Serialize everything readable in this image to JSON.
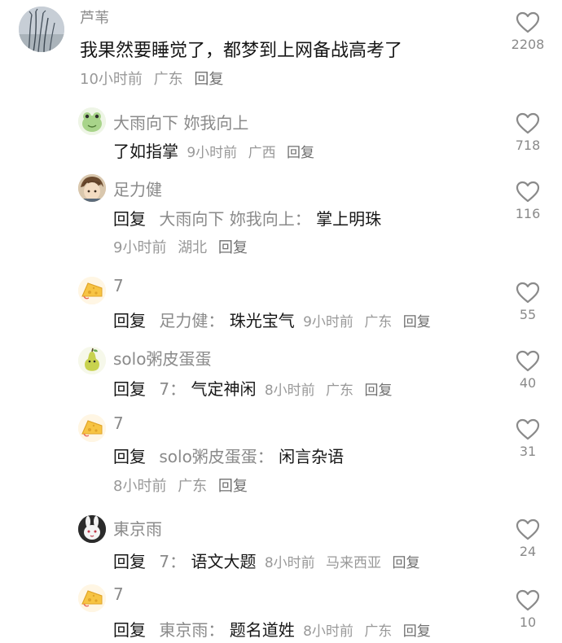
{
  "root_comment": {
    "username": "芦苇",
    "text": "我果然要睡觉了，都梦到上网备战高考了",
    "time": "10小时前",
    "location": "广东",
    "reply_label": "回复",
    "likes": "2208",
    "avatar": "reed-photo-avatar"
  },
  "replies": [
    {
      "username": "大雨向下 妳我向上",
      "prefix": "",
      "target": "",
      "text": "了如指掌",
      "time": "9小时前",
      "location": "广西",
      "reply_label": "回复",
      "likes": "718",
      "avatar": "frog-avatar"
    },
    {
      "username": "足力健",
      "prefix": "回复",
      "target": "大雨向下 妳我向上：",
      "text": "掌上明珠",
      "time": "9小时前",
      "location": "湖北",
      "reply_label": "回复",
      "likes": "116",
      "avatar": "anime-boy-avatar"
    },
    {
      "username": "7",
      "prefix": "回复",
      "target": "足力健：",
      "text": "珠光宝气",
      "time": "9小时前",
      "location": "广东",
      "reply_label": "回复",
      "likes": "55",
      "avatar": "cheese-avatar"
    },
    {
      "username": "solo粥皮蛋蛋",
      "prefix": "回复",
      "target": "7：",
      "text": "气定神闲",
      "time": "8小时前",
      "location": "广东",
      "reply_label": "回复",
      "likes": "40",
      "avatar": "pear-avatar"
    },
    {
      "username": "7",
      "prefix": "回复",
      "target": "solo粥皮蛋蛋：",
      "text": "闲言杂语",
      "time": "8小时前",
      "location": "广东",
      "reply_label": "回复",
      "likes": "31",
      "avatar": "cheese-avatar"
    },
    {
      "username": "東京雨",
      "prefix": "回复",
      "target": "7：",
      "text": "语文大题",
      "time": "8小时前",
      "location": "马来西亚",
      "reply_label": "回复",
      "likes": "24",
      "avatar": "bunny-avatar"
    },
    {
      "username": "7",
      "prefix": "回复",
      "target": "東京雨：",
      "text": "题名道姓",
      "time": "8小时前",
      "location": "广东",
      "reply_label": "回复",
      "likes": "10",
      "avatar": "cheese-avatar"
    }
  ],
  "colors": {
    "text_primary": "#161616",
    "text_secondary": "#8a8a8a",
    "text_meta": "#999999",
    "heart_outline": "#8a8a8a",
    "background": "#ffffff"
  },
  "icons": {
    "like": "heart-outline-icon"
  }
}
